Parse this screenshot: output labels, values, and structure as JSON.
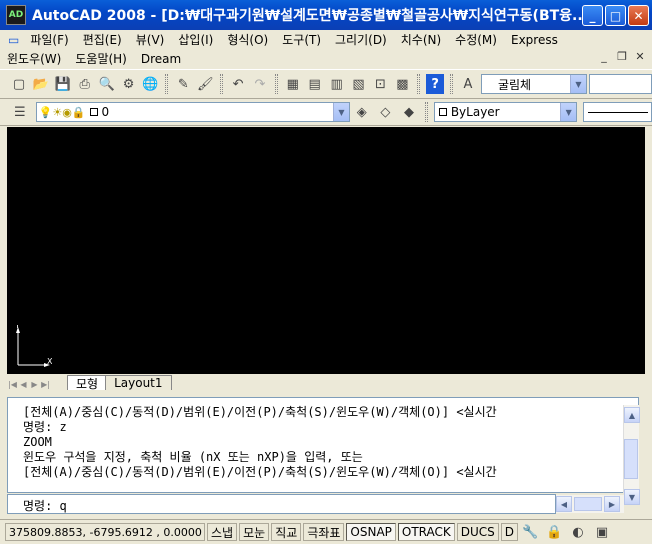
{
  "window": {
    "title": "AutoCAD 2008 - [D:₩대구과기원₩설계도면₩공종별₩철골공사₩지식연구동(BT융...",
    "app_icon": "AD"
  },
  "menu": {
    "row1": [
      "파일(F)",
      "편집(E)",
      "뷰(V)",
      "삽입(I)",
      "형식(O)",
      "도구(T)",
      "그리기(D)",
      "치수(N)",
      "수정(M)",
      "Express"
    ],
    "row2": [
      "윈도우(W)",
      "도움말(H)",
      "Dream"
    ]
  },
  "toolbar": {
    "font_combo": "굴림체",
    "layer_combo": "0",
    "color_combo": "ByLayer"
  },
  "drawing": {
    "background": "#000000",
    "ucs_x": "X",
    "ucs_y": "Y"
  },
  "tabs": {
    "model": "모형",
    "layout1": "Layout1"
  },
  "command": {
    "lines": [
      "[전체(A)/중심(C)/동적(D)/범위(E)/이전(P)/축척(S)/윈도우(W)/객체(O)] <실시간",
      "명령: z",
      "ZOOM",
      "윈도우 구석을 지정, 축척 비율 (nX 또는 nXP)을 입력, 또는",
      "[전체(A)/중심(C)/동적(D)/범위(E)/이전(P)/축척(S)/윈도우(W)/객체(O)] <실시간"
    ],
    "prompt": "명령: q"
  },
  "status": {
    "coords": "375809.8853, -6795.6912 , 0.0000",
    "toggles": [
      "스냅",
      "모눈",
      "직교",
      "극좌표",
      "OSNAP",
      "OTRACK",
      "DUCS",
      "D"
    ]
  }
}
